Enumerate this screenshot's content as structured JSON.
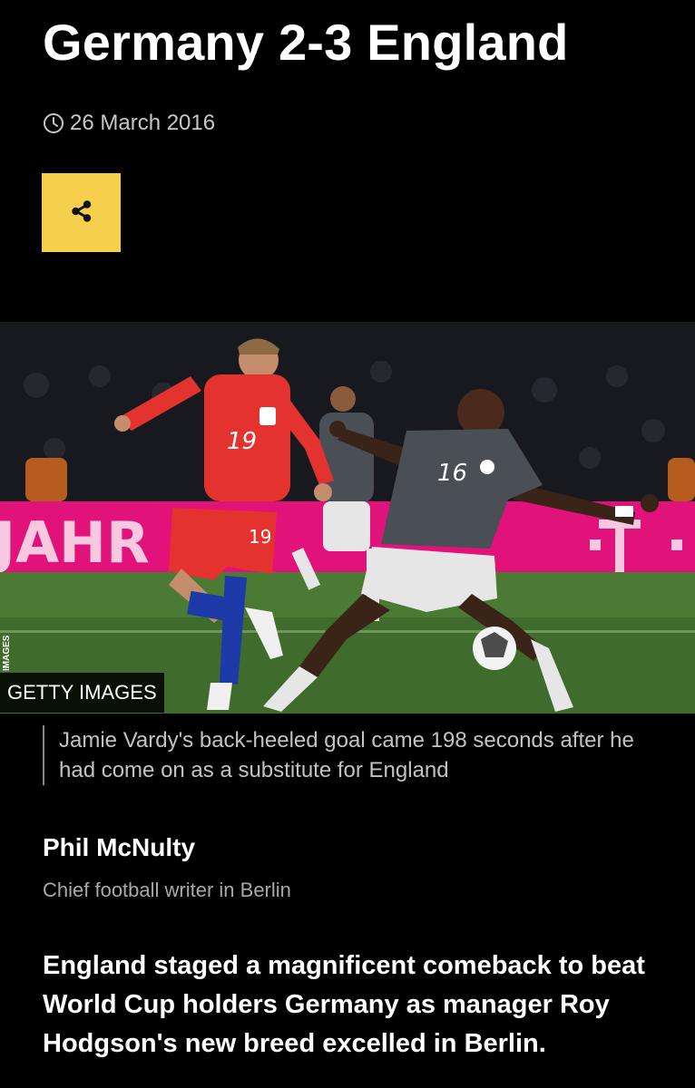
{
  "article": {
    "title": "Germany 2-3 England",
    "date": "26 March 2016",
    "share_icon": "share-icon",
    "clock_icon": "clock-icon"
  },
  "image": {
    "credit": "GETTY IMAGES",
    "vertical_credit": "IMAGES",
    "caption": "Jamie Vardy's back-heeled goal came 198 seconds after he had come on as a substitute for England",
    "board_text": "JAHR F",
    "numbers": {
      "england_shirt": "19",
      "england_shorts": "19",
      "germany_shirt": "16"
    }
  },
  "author": {
    "name": "Phil McNulty",
    "role": "Chief football writer in Berlin"
  },
  "lead_paragraph": "England staged a magnificent comeback to beat World Cup holders Germany as manager Roy Hodgson's new breed excelled in Berlin.",
  "colors": {
    "background": "#000000",
    "share_button": "#f6d04d",
    "england_red": "#e4322e",
    "germany_grey": "#4a4e55",
    "advert_pink": "#e2127b",
    "pitch_green": "#3f6b2c"
  }
}
